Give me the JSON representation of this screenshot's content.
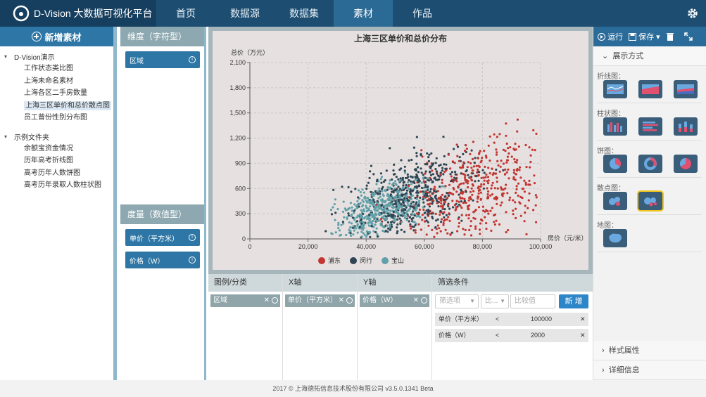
{
  "app": {
    "title": "D-Vision 大数据可视化平台"
  },
  "nav": {
    "items": [
      "首页",
      "数据源",
      "数据集",
      "素材",
      "作品"
    ],
    "active": "素材"
  },
  "left": {
    "add_label": "新增素材",
    "folders": [
      {
        "name": "D-Vision演示",
        "items": [
          "工作状态类比图",
          "上海未命名素材",
          "上海各区二手房数量",
          "上海三区单价和总价散点图",
          "员工曾份性别分布图"
        ],
        "selected": "上海三区单价和总价散点图"
      },
      {
        "name": "示例文件夹",
        "items": [
          "余额宝资金情况",
          "历年高考折线图",
          "高考历年人数饼图",
          "高考历年录取人数柱状图"
        ]
      }
    ]
  },
  "dims": {
    "dimension_header": "维度（字符型）",
    "dimension_pills": [
      "区域"
    ],
    "measure_header": "度量（数值型）",
    "measure_pills": [
      "单价（平方米）",
      "价格（W）"
    ]
  },
  "chart_data": {
    "type": "scatter",
    "title": "上海三区单价和总价分布",
    "xlabel": "房价（元/米）",
    "ylabel": "总价（万元）",
    "xlim": [
      0,
      100000
    ],
    "ylim": [
      0,
      2100
    ],
    "x_ticks": [
      "0",
      "20,000",
      "40,000",
      "60,000",
      "80,000",
      "100,000"
    ],
    "y_ticks": [
      "0",
      "300",
      "600",
      "900",
      "1,200",
      "1,500",
      "1,800",
      "2,100"
    ],
    "grid": true,
    "legend": "bottom",
    "series": [
      {
        "name": "浦东",
        "color": "#c23531"
      },
      {
        "name": "闵行",
        "color": "#2f4554"
      },
      {
        "name": "宝山",
        "color": "#61a0a8"
      }
    ]
  },
  "config": {
    "headers": [
      "图例/分类",
      "X轴",
      "Y轴",
      "筛选条件"
    ],
    "legend_field": "区域",
    "x_field": "单价（平方米）",
    "y_field": "价格（W）",
    "filter_placeholders": [
      "筛选项",
      "比...",
      "比较值"
    ],
    "add_filter_label": "新 增",
    "filters": [
      {
        "field": "单价（平方米）",
        "op": "<",
        "value": "100000"
      },
      {
        "field": "价格（W）",
        "op": "<",
        "value": "2000"
      }
    ]
  },
  "right": {
    "toolbar": {
      "run": "运行",
      "save": "保存"
    },
    "display_section": "展示方式",
    "groups": [
      "折线图：",
      "柱状图：",
      "饼图：",
      "散点图：",
      "地图："
    ],
    "style_section": "样式属性",
    "detail_section": "详细信息"
  },
  "footer": {
    "text": "2017 © 上海德拓信息技术股份有限公司 v3.5.0.1341 Beta"
  }
}
